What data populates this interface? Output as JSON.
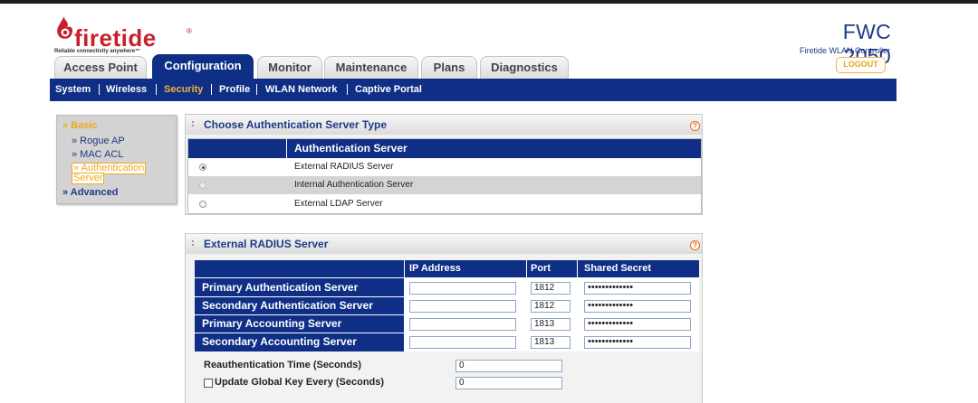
{
  "brand": {
    "logo_text": "firetide",
    "logo_tm": "®",
    "tagline": "Reliable connectivity anywhere™",
    "product": "FWC 2050",
    "product_sub": "Firetide WLAN Controller",
    "logout": "LOGOUT"
  },
  "tabs": [
    {
      "label": "Access Point",
      "active": false
    },
    {
      "label": "Configuration",
      "active": true
    },
    {
      "label": "Monitor",
      "active": false
    },
    {
      "label": "Maintenance",
      "active": false
    },
    {
      "label": "Plans",
      "active": false
    },
    {
      "label": "Diagnostics",
      "active": false
    }
  ],
  "subnav": [
    {
      "label": "System",
      "active": false
    },
    {
      "label": "Wireless",
      "active": false
    },
    {
      "label": "Security",
      "active": true
    },
    {
      "label": "Profile",
      "active": false
    },
    {
      "label": "WLAN Network",
      "active": false
    },
    {
      "label": "Captive Portal",
      "active": false
    }
  ],
  "leftmenu": {
    "basic": "» Basic",
    "items": [
      "» Rogue AP",
      "» MAC ACL"
    ],
    "active_line1": "» Authentication",
    "active_line2": "Server",
    "advanced": "» Advanced"
  },
  "auth_panel": {
    "title": "Choose Authentication Server Type",
    "help": "?",
    "column": "Authentication Server",
    "options": [
      {
        "label": "External RADIUS Server",
        "selected": true
      },
      {
        "label": "Internal Authentication Server",
        "selected": false
      },
      {
        "label": "External LDAP Server",
        "selected": false
      }
    ]
  },
  "radius_panel": {
    "title": "External RADIUS Server",
    "help": "?",
    "headers": {
      "ip": "IP Address",
      "port": "Port",
      "secret": "Shared Secret"
    },
    "rows": [
      {
        "label": "Primary Authentication Server",
        "ip": "",
        "port": "1812",
        "secret": "•••••••••••••"
      },
      {
        "label": "Secondary Authentication Server",
        "ip": "",
        "port": "1812",
        "secret": "•••••••••••••"
      },
      {
        "label": "Primary Accounting Server",
        "ip": "",
        "port": "1813",
        "secret": "•••••••••••••"
      },
      {
        "label": "Secondary Accounting Server",
        "ip": "",
        "port": "1813",
        "secret": "•••••••••••••"
      }
    ],
    "reauth_label": "Reauthentication Time (Seconds)",
    "reauth_value": "0",
    "global_key_label": "Update Global Key Every (Seconds)",
    "global_key_value": "0",
    "global_key_checked": false
  },
  "colors": {
    "navy": "#0f2f86",
    "accent_orange": "#f0a81e",
    "brand_red": "#c8202b"
  }
}
